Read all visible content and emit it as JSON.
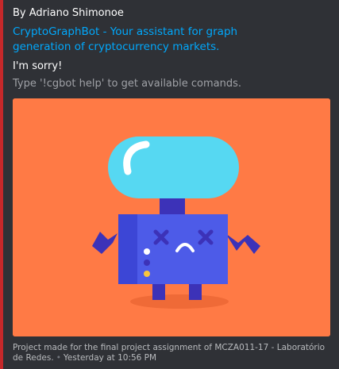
{
  "embed": {
    "accent_color": "#c5282a",
    "background_color": "#2f3136",
    "author": "By Adriano Shimonoe",
    "title": "CryptoGraphBot - Your assistant for graph generation of cryptocurrency markets.",
    "title_color": "#00a8fc",
    "description_title": "I'm sorry!",
    "description_hint": "Type '!cgbot help' to get available comands.",
    "image": {
      "icon": "sad-robot-illustration",
      "background_color": "#ff7a45"
    },
    "footer": {
      "text": "Project made for the final project assignment of MCZA011-17 - Laboratório de Redes.",
      "separator": "•",
      "timestamp": "Yesterday at 10:56 PM"
    }
  }
}
